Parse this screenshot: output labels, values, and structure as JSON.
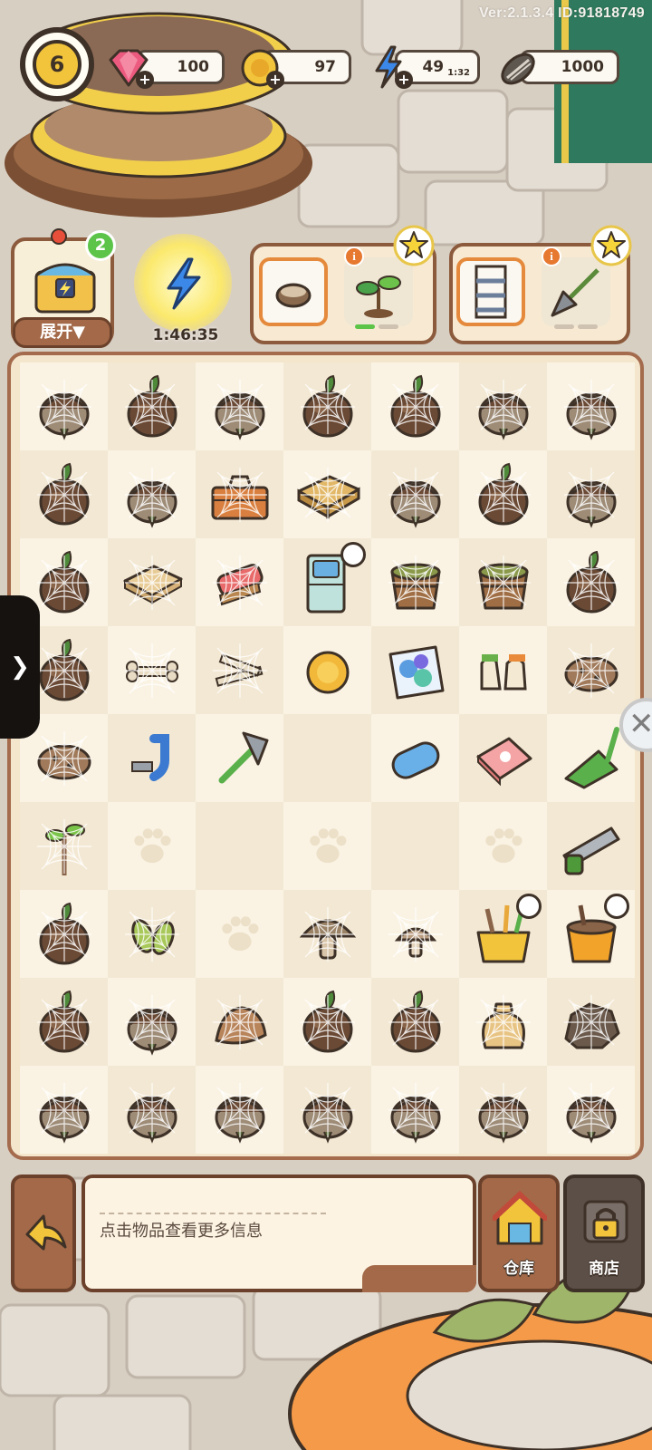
{
  "header": {
    "version": "Ver:2.1.3.4 ID:91818749",
    "level": "6",
    "gems": "100",
    "coins": "97",
    "energy": "49",
    "energy_timer": "1:32",
    "seeds": "1000"
  },
  "chest": {
    "count": "2",
    "expand_label": "展开▼"
  },
  "energy_boost": {
    "timer": "1:46:35"
  },
  "orders": [
    {
      "items": [
        "bowl-icon",
        "sprout-icon"
      ],
      "progress": 0.5
    },
    {
      "items": [
        "shelf-icon",
        "shovel-icon"
      ],
      "progress": 0.0
    }
  ],
  "board": {
    "rows": [
      [
        "acorn-sack",
        "acorn-leaf",
        "acorn-sack",
        "acorn-leaf",
        "acorn-leaf",
        "acorn-sack",
        "acorn-sack"
      ],
      [
        "acorn-leaf",
        "acorn-sack",
        "toolbox",
        "wooden-tray",
        "acorn-sack",
        "acorn-leaf",
        "acorn-sack"
      ],
      [
        "acorn-leaf",
        "wooden-crate",
        "scrub-brush",
        "blue-cabinet",
        "wooden-bucket",
        "wooden-bucket",
        "acorn-leaf"
      ],
      [
        "acorn-leaf",
        "bone",
        "bone-pile",
        "gold-coin",
        "soap-bag",
        "garden-gloves",
        "potato"
      ],
      [
        "potato",
        "blue-pipe",
        "axe",
        "",
        "blue-soap",
        "pink-towel",
        "green-dustpan"
      ],
      [
        "sapling",
        "",
        "",
        "",
        "",
        "",
        "green-saw"
      ],
      [
        "acorn-leaf",
        "seed-pods",
        "",
        "mushroom",
        "mushroom-small",
        "tool-basket",
        "orange-bucket"
      ],
      [
        "acorn-leaf",
        "acorn-sack",
        "burlap-sack",
        "acorn-leaf",
        "acorn-leaf",
        "sack-bag",
        "rock"
      ],
      [
        "acorn-sack",
        "acorn-sack",
        "acorn-sack",
        "acorn-sack",
        "acorn-sack",
        "acorn-sack",
        "acorn-sack"
      ]
    ]
  },
  "info_panel": {
    "hint": "点击物品查看更多信息"
  },
  "buttons": {
    "warehouse": "仓库",
    "shop": "商店"
  },
  "colors": {
    "panel_border": "#a46b4d",
    "board_bg": "#f4e6cc",
    "accent_orange": "#e58a3c",
    "progress_green": "#5cc448"
  }
}
